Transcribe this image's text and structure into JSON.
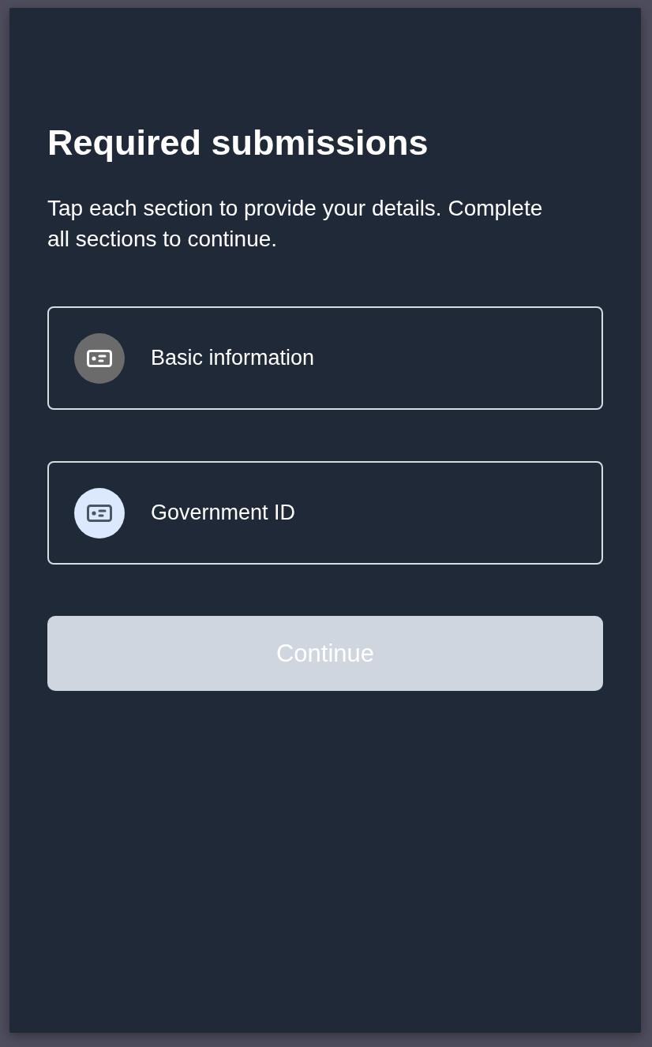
{
  "title": "Required submissions",
  "description": "Tap each section to provide your details. Complete all sections to continue.",
  "sections": [
    {
      "label": "Basic information",
      "active": false
    },
    {
      "label": "Government ID",
      "active": true
    }
  ],
  "continue_button": {
    "label": "Continue",
    "disabled": true
  }
}
